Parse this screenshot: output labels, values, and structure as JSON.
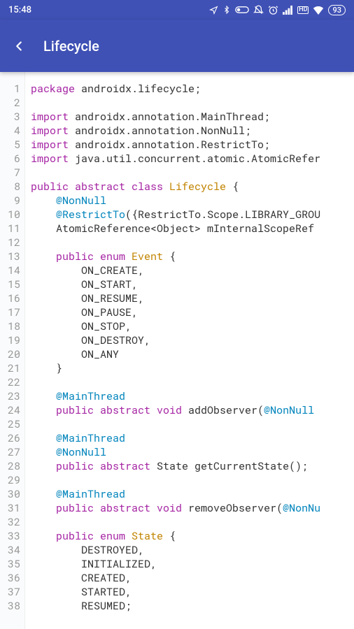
{
  "status_bar": {
    "time": "15:48",
    "battery": "93",
    "icons": {
      "location": "location-icon",
      "bluetooth": "bluetooth-icon",
      "vpn": "vpn-icon",
      "dnd": "dnd-icon",
      "alarm": "alarm-icon",
      "signal": "signal-icon",
      "hd": "HD",
      "wifi": "wifi-icon",
      "battery_pill": "battery-icon"
    }
  },
  "app_bar": {
    "title": "Lifecycle"
  },
  "code": {
    "lines": [
      [
        {
          "t": "package ",
          "c": "kw"
        },
        {
          "t": "androidx.lifecycle;",
          "c": "id"
        }
      ],
      [],
      [
        {
          "t": "import ",
          "c": "kw"
        },
        {
          "t": "androidx.annotation.MainThread;",
          "c": "id"
        }
      ],
      [
        {
          "t": "import ",
          "c": "kw"
        },
        {
          "t": "androidx.annotation.NonNull;",
          "c": "id"
        }
      ],
      [
        {
          "t": "import ",
          "c": "kw"
        },
        {
          "t": "androidx.annotation.RestrictTo;",
          "c": "id"
        }
      ],
      [
        {
          "t": "import ",
          "c": "kw"
        },
        {
          "t": "java.util.concurrent.atomic.AtomicRefer",
          "c": "id"
        }
      ],
      [],
      [
        {
          "t": "public abstract class ",
          "c": "kw"
        },
        {
          "t": "Lifecycle ",
          "c": "cls"
        },
        {
          "t": "{",
          "c": "punc"
        }
      ],
      [
        {
          "t": "    ",
          "c": "id"
        },
        {
          "t": "@NonNull",
          "c": "ann"
        }
      ],
      [
        {
          "t": "    ",
          "c": "id"
        },
        {
          "t": "@RestrictTo",
          "c": "ann"
        },
        {
          "t": "({RestrictTo.Scope.LIBRARY_GROU",
          "c": "id"
        }
      ],
      [
        {
          "t": "    AtomicReference<Object> mInternalScopeRef ",
          "c": "id"
        }
      ],
      [],
      [
        {
          "t": "    ",
          "c": "id"
        },
        {
          "t": "public enum ",
          "c": "kw"
        },
        {
          "t": "Event ",
          "c": "cls"
        },
        {
          "t": "{",
          "c": "punc"
        }
      ],
      [
        {
          "t": "        ON_CREATE,",
          "c": "id"
        }
      ],
      [
        {
          "t": "        ON_START,",
          "c": "id"
        }
      ],
      [
        {
          "t": "        ON_RESUME,",
          "c": "id"
        }
      ],
      [
        {
          "t": "        ON_PAUSE,",
          "c": "id"
        }
      ],
      [
        {
          "t": "        ON_STOP,",
          "c": "id"
        }
      ],
      [
        {
          "t": "        ON_DESTROY,",
          "c": "id"
        }
      ],
      [
        {
          "t": "        ON_ANY",
          "c": "id"
        }
      ],
      [
        {
          "t": "    }",
          "c": "punc"
        }
      ],
      [],
      [
        {
          "t": "    ",
          "c": "id"
        },
        {
          "t": "@MainThread",
          "c": "ann"
        }
      ],
      [
        {
          "t": "    ",
          "c": "id"
        },
        {
          "t": "public abstract void ",
          "c": "kw"
        },
        {
          "t": "addObserver(",
          "c": "id"
        },
        {
          "t": "@NonNull ",
          "c": "ann"
        }
      ],
      [],
      [
        {
          "t": "    ",
          "c": "id"
        },
        {
          "t": "@MainThread",
          "c": "ann"
        }
      ],
      [
        {
          "t": "    ",
          "c": "id"
        },
        {
          "t": "@NonNull",
          "c": "ann"
        }
      ],
      [
        {
          "t": "    ",
          "c": "id"
        },
        {
          "t": "public abstract ",
          "c": "kw"
        },
        {
          "t": "State getCurrentState();",
          "c": "id"
        }
      ],
      [],
      [
        {
          "t": "    ",
          "c": "id"
        },
        {
          "t": "@MainThread",
          "c": "ann"
        }
      ],
      [
        {
          "t": "    ",
          "c": "id"
        },
        {
          "t": "public abstract void ",
          "c": "kw"
        },
        {
          "t": "removeObserver(",
          "c": "id"
        },
        {
          "t": "@NonNu",
          "c": "ann"
        }
      ],
      [],
      [
        {
          "t": "    ",
          "c": "id"
        },
        {
          "t": "public enum ",
          "c": "kw"
        },
        {
          "t": "State ",
          "c": "cls"
        },
        {
          "t": "{",
          "c": "punc"
        }
      ],
      [
        {
          "t": "        DESTROYED,",
          "c": "id"
        }
      ],
      [
        {
          "t": "        INITIALIZED,",
          "c": "id"
        }
      ],
      [
        {
          "t": "        CREATED,",
          "c": "id"
        }
      ],
      [
        {
          "t": "        STARTED,",
          "c": "id"
        }
      ],
      [
        {
          "t": "        RESUMED;",
          "c": "id"
        }
      ]
    ]
  }
}
